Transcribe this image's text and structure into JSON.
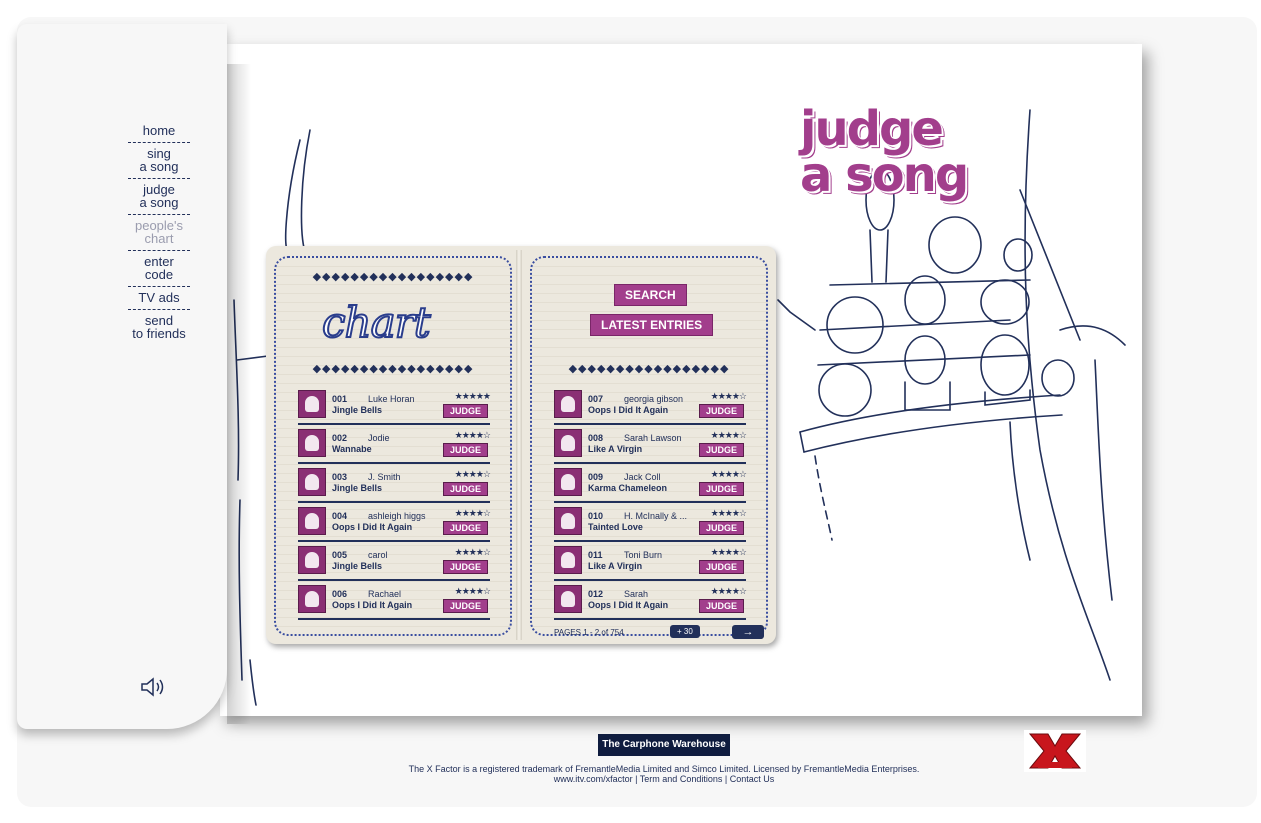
{
  "nav": {
    "items": [
      {
        "label": "home",
        "active": false
      },
      {
        "label": "sing\na song",
        "active": false
      },
      {
        "label": "judge\na song",
        "active": false
      },
      {
        "label": "people's\nchart",
        "active": true
      },
      {
        "label": "enter\ncode",
        "active": false
      },
      {
        "label": "TV ads",
        "active": false
      },
      {
        "label": "send\nto friends",
        "active": false
      }
    ]
  },
  "logo": {
    "line1": "judge",
    "line2": "a song"
  },
  "chart_panel": {
    "title": "chart"
  },
  "buttons": {
    "search": "SEARCH",
    "latest": "LATEST ENTRIES"
  },
  "entries_left": [
    {
      "num": "001",
      "name": "Luke Horan",
      "song": "Jingle Bells",
      "stars": "★★★★★",
      "judge": "JUDGE"
    },
    {
      "num": "002",
      "name": "Jodie",
      "song": "Wannabe",
      "stars": "★★★★☆",
      "judge": "JUDGE"
    },
    {
      "num": "003",
      "name": "J. Smith",
      "song": "Jingle Bells",
      "stars": "★★★★☆",
      "judge": "JUDGE"
    },
    {
      "num": "004",
      "name": "ashleigh higgs",
      "song": "Oops I Did It Again",
      "stars": "★★★★☆",
      "judge": "JUDGE"
    },
    {
      "num": "005",
      "name": "carol",
      "song": "Jingle Bells",
      "stars": "★★★★☆",
      "judge": "JUDGE"
    },
    {
      "num": "006",
      "name": "Rachael",
      "song": "Oops I Did It Again",
      "stars": "★★★★☆",
      "judge": "JUDGE"
    }
  ],
  "entries_right": [
    {
      "num": "007",
      "name": "georgia gibson",
      "song": "Oops I Did It Again",
      "stars": "★★★★☆",
      "judge": "JUDGE"
    },
    {
      "num": "008",
      "name": "Sarah Lawson",
      "song": "Like A Virgin",
      "stars": "★★★★☆",
      "judge": "JUDGE"
    },
    {
      "num": "009",
      "name": "Jack Coll",
      "song": "Karma Chameleon",
      "stars": "★★★★☆",
      "judge": "JUDGE"
    },
    {
      "num": "010",
      "name": "H. McInally & ...",
      "song": "Tainted Love",
      "stars": "★★★★☆",
      "judge": "JUDGE"
    },
    {
      "num": "011",
      "name": "Toni Burn",
      "song": "Like A Virgin",
      "stars": "★★★★☆",
      "judge": "JUDGE"
    },
    {
      "num": "012",
      "name": "Sarah",
      "song": "Oops I Did It Again",
      "stars": "★★★★☆",
      "judge": "JUDGE"
    }
  ],
  "pager": {
    "pages_text": "PAGES 1 - 2 of 754",
    "plus": "+ 30",
    "next": "→"
  },
  "footer": {
    "sponsor": "The Carphone Warehouse",
    "trademark": "The X Factor is a registered trademark of FremantleMedia Limited and Simco Limited. Licensed by FremantleMedia Enterprises.",
    "link_site": "www.itv.com/xfactor",
    "link_terms": "Term and Conditions",
    "link_contact": "Contact Us",
    "separator": "|"
  },
  "icons": {
    "speaker": "speaker-icon",
    "xfactor": "x-factor-logo"
  },
  "colors": {
    "accent": "#a23e8c",
    "ink": "#22305a"
  }
}
